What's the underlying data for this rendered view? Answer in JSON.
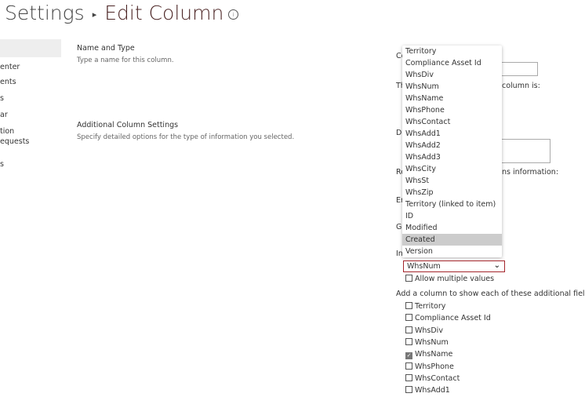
{
  "header": {
    "breadcrumb_parent": "Settings",
    "breadcrumb_current": "Edit Column",
    "info_icon": "info-circle-icon"
  },
  "nav": {
    "items": [
      "enter",
      "ents",
      "s",
      "ar",
      "tion",
      "equests",
      "s"
    ]
  },
  "sections": [
    {
      "title": "Name and Type",
      "description": "Type a name for this column."
    },
    {
      "title": "Additional Column Settings",
      "description": "Specify detailed options for the type of information you selected."
    }
  ],
  "form_fragments": {
    "a": "Co",
    "b": "Th",
    "b2": "column is:",
    "c": "De",
    "d": "Re",
    "d2": "ns information:",
    "e": "En",
    "f": "Ge",
    "g": "In"
  },
  "dropdown": {
    "options": [
      "Territory",
      "Compliance Asset Id",
      "WhsDiv",
      "WhsNum",
      "WhsName",
      "WhsPhone",
      "WhsContact",
      "WhsAdd1",
      "WhsAdd2",
      "WhsAdd3",
      "WhsCity",
      "WhsSt",
      "WhsZip",
      "Territory (linked to item)",
      "ID",
      "Modified",
      "Created",
      "Version"
    ],
    "highlighted": "Created"
  },
  "lookup_select": {
    "value": "WhsNum"
  },
  "allow_multiple": {
    "label": "Allow multiple values",
    "checked": false
  },
  "additional_fields": {
    "label": "Add a column to show each of these additional fields:",
    "items": [
      {
        "label": "Territory",
        "checked": false
      },
      {
        "label": "Compliance Asset Id",
        "checked": false
      },
      {
        "label": "WhsDiv",
        "checked": false
      },
      {
        "label": "WhsNum",
        "checked": false
      },
      {
        "label": "WhsName",
        "checked": true
      },
      {
        "label": "WhsPhone",
        "checked": false
      },
      {
        "label": "WhsContact",
        "checked": false
      },
      {
        "label": "WhsAdd1",
        "checked": false
      }
    ]
  },
  "colors": {
    "accent_error": "#a4262c",
    "highlight": "#cccccc"
  }
}
